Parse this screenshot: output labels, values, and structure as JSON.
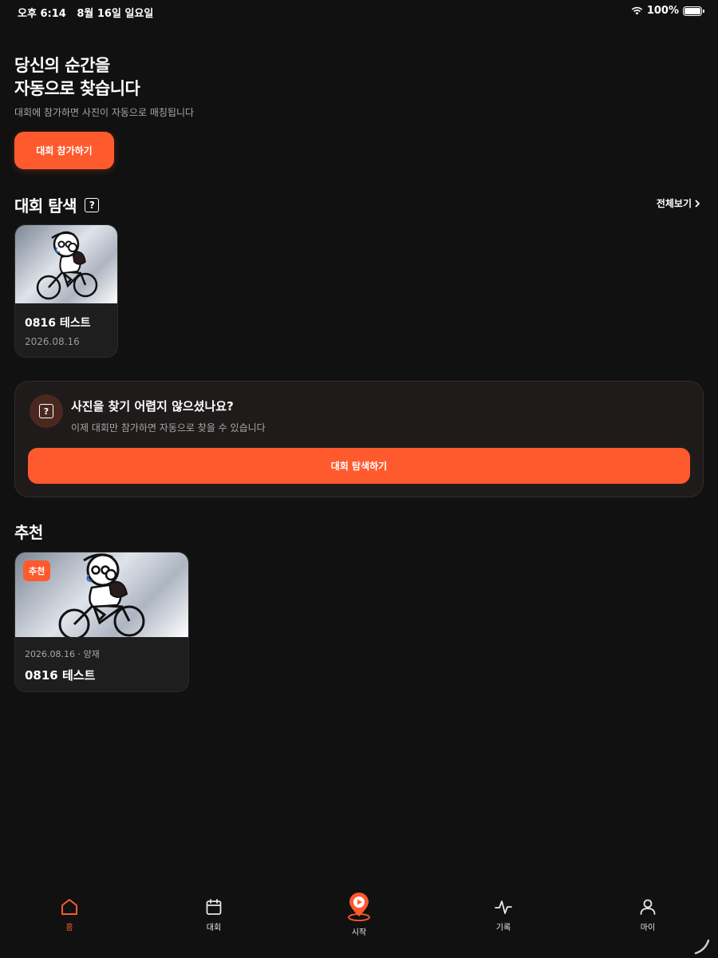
{
  "status": {
    "time": "오후 6:14",
    "date": "8월 16일 일요일",
    "battery": "100%"
  },
  "hero": {
    "title_line1": "당신의 순간을",
    "title_line2": "자동으로 찾습니다",
    "subtitle": "대회에 참가하면 사진이 자동으로 매칭됩니다",
    "join_button": "대회 참가하기"
  },
  "explore": {
    "title": "대회 탐색",
    "help_icon": "?",
    "see_all": "전체보기",
    "events": [
      {
        "name": "0816 테스트",
        "date": "2026.08.16"
      }
    ]
  },
  "help_card": {
    "icon": "?",
    "title": "사진을 찾기 어렵지 않으셨나요?",
    "subtitle": "이제 대회만 참가하면 자동으로 찾을 수 있습니다",
    "button": "대회 탐색하기"
  },
  "recommend": {
    "title": "추천",
    "items": [
      {
        "badge": "추천",
        "meta": "2026.08.16 · 양재",
        "name": "0816 테스트"
      }
    ]
  },
  "tabs": [
    {
      "label": "홈",
      "icon": "home-icon",
      "active": true
    },
    {
      "label": "대회",
      "icon": "calendar-icon",
      "active": false
    },
    {
      "label": "시작",
      "icon": "start-pin-icon",
      "active": false
    },
    {
      "label": "기록",
      "icon": "activity-icon",
      "active": false
    },
    {
      "label": "마이",
      "icon": "user-icon",
      "active": false
    }
  ],
  "colors": {
    "background": "#111111",
    "accent": "#ff5a2e",
    "card": "#1e1e1e",
    "muted_text": "#a8a8a8"
  }
}
